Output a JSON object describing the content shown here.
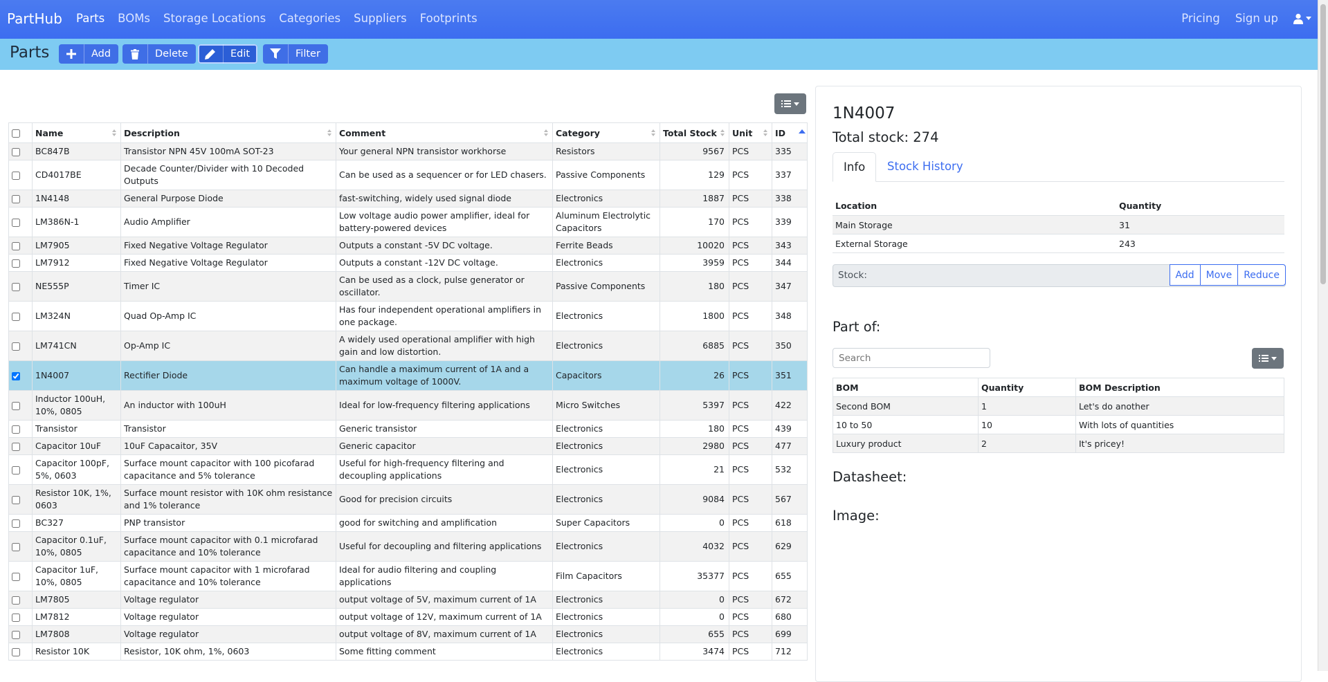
{
  "navbar": {
    "brand": "PartHub",
    "links": [
      "Parts",
      "BOMs",
      "Storage Locations",
      "Categories",
      "Suppliers",
      "Footprints"
    ],
    "active": "Parts",
    "right": [
      "Pricing",
      "Sign up"
    ],
    "user_icon": "user-icon"
  },
  "toolbar": {
    "title": "Parts",
    "add": "Add",
    "delete": "Delete",
    "edit": "Edit",
    "filter": "Filter"
  },
  "table": {
    "columns": [
      "Name",
      "Description",
      "Comment",
      "Category",
      "Total Stock",
      "Unit",
      "ID"
    ],
    "rows": [
      {
        "name": "BC847B",
        "description": "Transistor NPN 45V 100mA SOT-23",
        "comment": "Your general NPN transistor workhorse",
        "category": "Resistors",
        "stock": "9567",
        "unit": "PCS",
        "id": "335",
        "checked": false
      },
      {
        "name": "CD4017BE",
        "description": "Decade Counter/Divider with 10 Decoded Outputs",
        "comment": "Can be used as a sequencer or for LED chasers.",
        "category": "Passive Components",
        "stock": "129",
        "unit": "PCS",
        "id": "337",
        "checked": false
      },
      {
        "name": "1N4148",
        "description": "General Purpose Diode",
        "comment": "fast-switching, widely used signal diode",
        "category": "Electronics",
        "stock": "1887",
        "unit": "PCS",
        "id": "338",
        "checked": false
      },
      {
        "name": "LM386N-1",
        "description": "Audio Amplifier",
        "comment": "Low voltage audio power amplifier, ideal for battery-powered devices",
        "category": "Aluminum Electrolytic Capacitors",
        "stock": "170",
        "unit": "PCS",
        "id": "339",
        "checked": false
      },
      {
        "name": "LM7905",
        "description": "Fixed Negative Voltage Regulator",
        "comment": "Outputs a constant -5V DC voltage.",
        "category": "Ferrite Beads",
        "stock": "10020",
        "unit": "PCS",
        "id": "343",
        "checked": false
      },
      {
        "name": "LM7912",
        "description": "Fixed Negative Voltage Regulator",
        "comment": "Outputs a constant -12V DC voltage.",
        "category": "Electronics",
        "stock": "3959",
        "unit": "PCS",
        "id": "344",
        "checked": false
      },
      {
        "name": "NE555P",
        "description": "Timer IC",
        "comment": "Can be used as a clock, pulse generator or oscillator.",
        "category": "Passive Components",
        "stock": "180",
        "unit": "PCS",
        "id": "347",
        "checked": false
      },
      {
        "name": "LM324N",
        "description": "Quad Op-Amp IC",
        "comment": "Has four independent operational amplifiers in one package.",
        "category": "Electronics",
        "stock": "1800",
        "unit": "PCS",
        "id": "348",
        "checked": false
      },
      {
        "name": "LM741CN",
        "description": "Op-Amp IC",
        "comment": "A widely used operational amplifier with high gain and low distortion.",
        "category": "Electronics",
        "stock": "6885",
        "unit": "PCS",
        "id": "350",
        "checked": false
      },
      {
        "name": "1N4007",
        "description": "Rectifier Diode",
        "comment": "Can handle a maximum current of 1A and a maximum voltage of 1000V.",
        "category": "Capacitors",
        "stock": "26",
        "unit": "PCS",
        "id": "351",
        "checked": true
      },
      {
        "name": "Inductor 100uH, 10%, 0805",
        "description": "An inductor with 100uH",
        "comment": "Ideal for low-frequency filtering applications",
        "category": "Micro Switches",
        "stock": "5397",
        "unit": "PCS",
        "id": "422",
        "checked": false
      },
      {
        "name": "Transistor",
        "description": "Transistor",
        "comment": "Generic transistor",
        "category": "Electronics",
        "stock": "180",
        "unit": "PCS",
        "id": "439",
        "checked": false
      },
      {
        "name": "Capacitor 10uF",
        "description": "10uF Capacaitor, 35V",
        "comment": "Generic capacitor",
        "category": "Electronics",
        "stock": "2980",
        "unit": "PCS",
        "id": "477",
        "checked": false
      },
      {
        "name": "Capacitor 100pF, 5%, 0603",
        "description": "Surface mount capacitor with 100 picofarad capacitance and 5% tolerance",
        "comment": "Useful for high-frequency filtering and decoupling applications",
        "category": "Electronics",
        "stock": "21",
        "unit": "PCS",
        "id": "532",
        "checked": false
      },
      {
        "name": "Resistor 10K, 1%, 0603",
        "description": "Surface mount resistor with 10K ohm resistance and 1% tolerance",
        "comment": "Good for precision circuits",
        "category": "Electronics",
        "stock": "9084",
        "unit": "PCS",
        "id": "567",
        "checked": false
      },
      {
        "name": "BC327",
        "description": "PNP transistor",
        "comment": "good for switching and amplification",
        "category": "Super Capacitors",
        "stock": "0",
        "unit": "PCS",
        "id": "618",
        "checked": false
      },
      {
        "name": "Capacitor 0.1uF, 10%, 0805",
        "description": "Surface mount capacitor with 0.1 microfarad capacitance and 10% tolerance",
        "comment": "Useful for decoupling and filtering applications",
        "category": "Electronics",
        "stock": "4032",
        "unit": "PCS",
        "id": "629",
        "checked": false
      },
      {
        "name": "Capacitor 1uF, 10%, 0805",
        "description": "Surface mount capacitor with 1 microfarad capacitance and 10% tolerance",
        "comment": "Ideal for audio filtering and coupling applications",
        "category": "Film Capacitors",
        "stock": "35377",
        "unit": "PCS",
        "id": "655",
        "checked": false
      },
      {
        "name": "LM7805",
        "description": "Voltage regulator",
        "comment": "output voltage of 5V, maximum current of 1A",
        "category": "Electronics",
        "stock": "0",
        "unit": "PCS",
        "id": "672",
        "checked": false
      },
      {
        "name": "LM7812",
        "description": "Voltage regulator",
        "comment": "output voltage of 12V, maximum current of 1A",
        "category": "Electronics",
        "stock": "0",
        "unit": "PCS",
        "id": "680",
        "checked": false
      },
      {
        "name": "LM7808",
        "description": "Voltage regulator",
        "comment": "output voltage of 8V, maximum current of 1A",
        "category": "Electronics",
        "stock": "655",
        "unit": "PCS",
        "id": "699",
        "checked": false
      },
      {
        "name": "Resistor 10K",
        "description": "Resistor, 10K ohm, 1%, 0603",
        "comment": "Some fitting comment",
        "category": "Electronics",
        "stock": "3474",
        "unit": "PCS",
        "id": "712",
        "checked": false
      }
    ]
  },
  "detail": {
    "name": "1N4007",
    "total_stock": "Total stock: 274",
    "tabs": [
      "Info",
      "Stock History"
    ],
    "locations_header": [
      "Location",
      "Quantity"
    ],
    "locations": [
      {
        "location": "Main Storage",
        "quantity": "31"
      },
      {
        "location": "External Storage",
        "quantity": "243"
      }
    ],
    "stock_label": "Stock:",
    "stock_buttons": [
      "Add",
      "Move",
      "Reduce"
    ],
    "part_of": "Part of:",
    "search_placeholder": "Search",
    "bom_header": [
      "BOM",
      "Quantity",
      "BOM Description"
    ],
    "boms": [
      {
        "bom": "Second BOM",
        "quantity": "1",
        "description": "Let's do another"
      },
      {
        "bom": "10 to 50",
        "quantity": "10",
        "description": "With lots of quantities"
      },
      {
        "bom": "Luxury product",
        "quantity": "2",
        "description": "It's pricey!"
      }
    ],
    "datasheet": "Datasheet:",
    "image": "Image:"
  },
  "colors": {
    "navbar": "#3c6df0",
    "subbar": "#7ecbf2",
    "selected_row": "#a6d7ea",
    "link": "#3c6df0"
  }
}
